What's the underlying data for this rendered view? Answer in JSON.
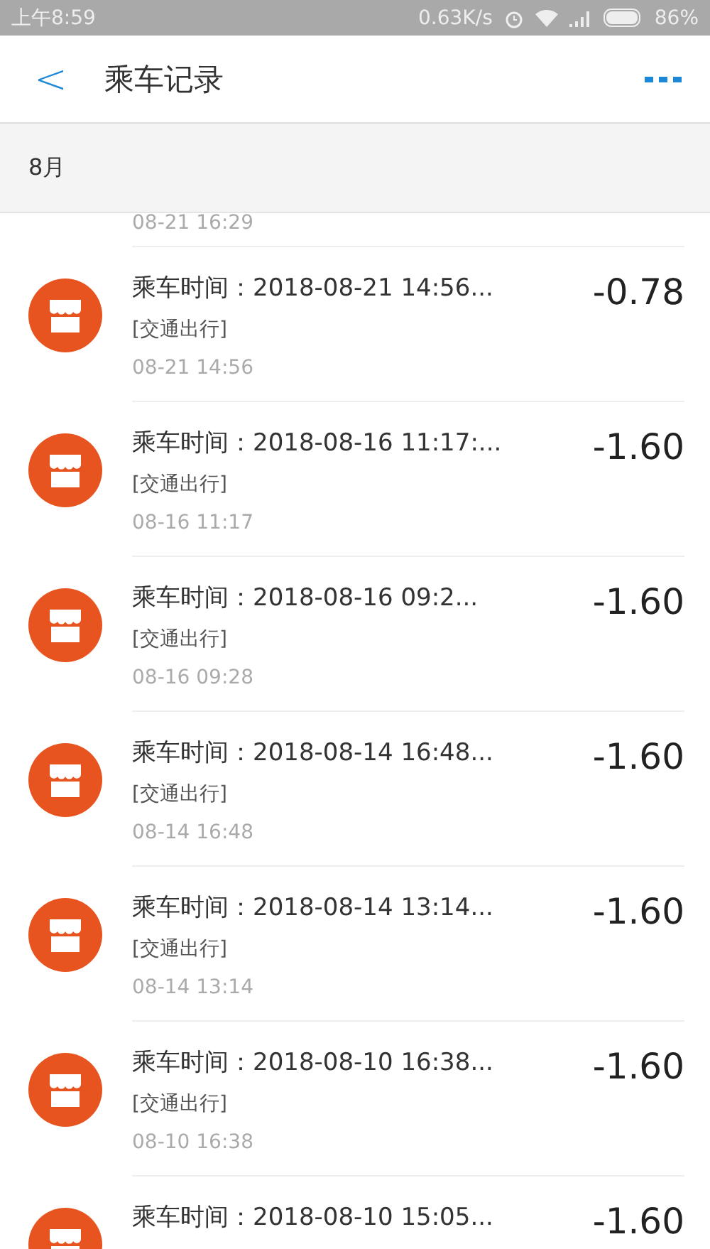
{
  "status_bar": {
    "time": "上午8:59",
    "speed": "0.63K/s",
    "battery": "86%"
  },
  "header": {
    "back": "<",
    "title": "乘车记录"
  },
  "month": "8月",
  "partial_top": {
    "time": "08-21  16:29"
  },
  "records": [
    {
      "title": "乘车时间：2018-08-21 14:56...",
      "category": "[交通出行]",
      "time": "08-21  14:56",
      "amount": "-0.78"
    },
    {
      "title": "乘车时间：2018-08-16 11:17:...",
      "category": "[交通出行]",
      "time": "08-16  11:17",
      "amount": "-1.60"
    },
    {
      "title": "乘车时间：2018-08-16 09:2...",
      "category": "[交通出行]",
      "time": "08-16  09:28",
      "amount": "-1.60"
    },
    {
      "title": "乘车时间：2018-08-14 16:48...",
      "category": "[交通出行]",
      "time": "08-14  16:48",
      "amount": "-1.60"
    },
    {
      "title": "乘车时间：2018-08-14 13:14...",
      "category": "[交通出行]",
      "time": "08-14  13:14",
      "amount": "-1.60"
    },
    {
      "title": "乘车时间：2018-08-10 16:38...",
      "category": "[交通出行]",
      "time": "08-10  16:38",
      "amount": "-1.60"
    },
    {
      "title": "乘车时间：2018-08-10 15:05...",
      "amount": "-1.60"
    }
  ]
}
